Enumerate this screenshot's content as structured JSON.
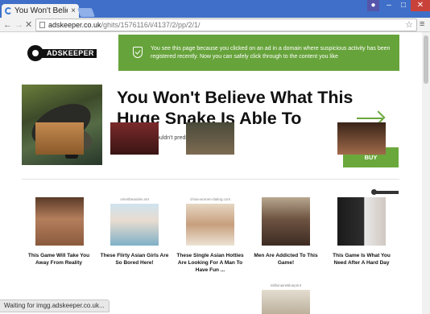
{
  "browser": {
    "tab_title": "You Won't Believe W",
    "tab_close": "×",
    "url_host": "adskeeper.co.uk",
    "url_path": "/ghits/1576116/i/4137/2/pp/2/1/",
    "status": "Waiting for imgg.adskeeper.co.uk..."
  },
  "logo": {
    "text": "ADSKEEPER"
  },
  "notice": {
    "text": "You see this page because you clicked on an ad in a domain where suspicious activity has been registered recently. Now you can safely click through to the content you like"
  },
  "hero": {
    "headline": "You Won't Believe What This Huge Snake Is Able To",
    "subtitle": "Poor diver! he couldn't predict it!",
    "buy_label": "BUY"
  },
  "cards": [
    {
      "source": "",
      "title": "This Game Will Take You Away From Reality"
    },
    {
      "source": "orientbeauties.net",
      "title": "These Flirty Asian Girls Are So Bored Here!"
    },
    {
      "source": "china-women-dating.com",
      "title": "These Single Asian Hotties Are Looking For A Man To Have Fun ..."
    },
    {
      "source": "",
      "title": "Men Are Addicted To This Game!"
    },
    {
      "source": "",
      "title": "This Game Is What You Need After A Hard Day"
    }
  ],
  "row2_source": "MillionaireBlueprint",
  "colors": {
    "accent": "#6aa83c",
    "notice_bg": "#67a33b",
    "chrome_blue": "#3f6fc8"
  }
}
